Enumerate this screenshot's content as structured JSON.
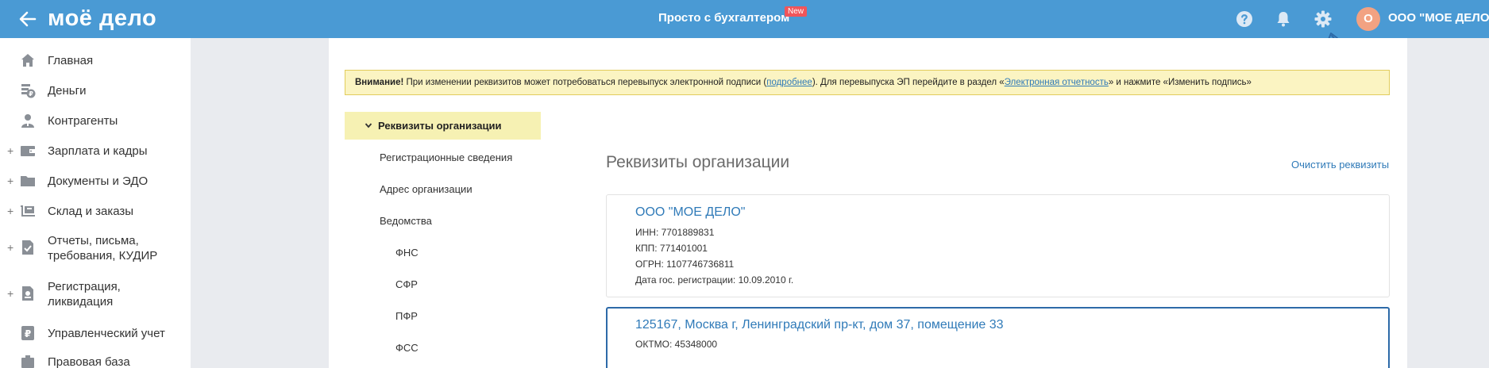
{
  "topbar": {
    "logo": "моё дело",
    "center_title": "Просто с бухгалтером",
    "badge": "New",
    "avatar_letter": "О",
    "org_name": "ООО \"МОЕ ДЕЛО\"",
    "icons": [
      "back-arrow-icon",
      "help-icon",
      "bell-icon",
      "gear-icon"
    ]
  },
  "sidebar": {
    "items": [
      {
        "label": "Главная",
        "icon": "home-icon",
        "expandable": false
      },
      {
        "label": "Деньги",
        "icon": "money-icon",
        "expandable": false
      },
      {
        "label": "Контрагенты",
        "icon": "contractors-icon",
        "expandable": false
      },
      {
        "label": "Зарплата и кадры",
        "icon": "salary-icon",
        "expandable": true
      },
      {
        "label": "Документы и ЭДО",
        "icon": "folder-icon",
        "expandable": true
      },
      {
        "label": "Склад и заказы",
        "icon": "warehouse-icon",
        "expandable": true
      },
      {
        "label_line1": "Отчеты, письма,",
        "label_line2": "требования, КУДИР",
        "icon": "reports-icon",
        "expandable": true
      },
      {
        "label_line1": "Регистрация,",
        "label_line2": "ликвидация",
        "icon": "registration-icon",
        "expandable": true
      },
      {
        "label": "Управленческий учет",
        "icon": "management-icon",
        "expandable": false
      },
      {
        "label": "Правовая база",
        "icon": "law-icon",
        "expandable": false
      }
    ]
  },
  "warning": {
    "bold": "Внимание!",
    "text1": " При изменении реквизитов может потребоваться перевыпуск электронной подписи (",
    "link1": "подробнее",
    "text2": "). Для перевыпуска ЭП перейдите в раздел «",
    "link2": "Электронная отчетность",
    "text3": "» и нажмите «Изменить подпись»"
  },
  "subnav": {
    "active": "Реквизиты организации",
    "items": [
      "Регистрационные сведения",
      "Адрес организации",
      "Ведомства"
    ],
    "subitems": [
      "ФНС",
      "СФР",
      "ПФР",
      "ФСС"
    ]
  },
  "main": {
    "title": "Реквизиты организации",
    "clear_link": "Очистить реквизиты",
    "card1": {
      "name": "ООО  \"МОЕ ДЕЛО\"",
      "inn": "ИНН: 7701889831",
      "kpp": "КПП: 771401001",
      "ogrn": "ОГРН: 1107746736811",
      "date": "Дата гос. регистрации: 10.09.2010 г."
    },
    "card2": {
      "address": "125167, Москва г, Ленинградский пр-кт, дом 37, помещение 33",
      "oktmo": "ОКТМО: 45348000"
    }
  },
  "colors": {
    "topbar": "#4a9ad4",
    "link": "#2f7ab8",
    "warning_bg": "#fbf4c2",
    "active_subnav": "#f6f1b3",
    "selected_card_border": "#2d6aa8",
    "badge": "#f0555a"
  }
}
